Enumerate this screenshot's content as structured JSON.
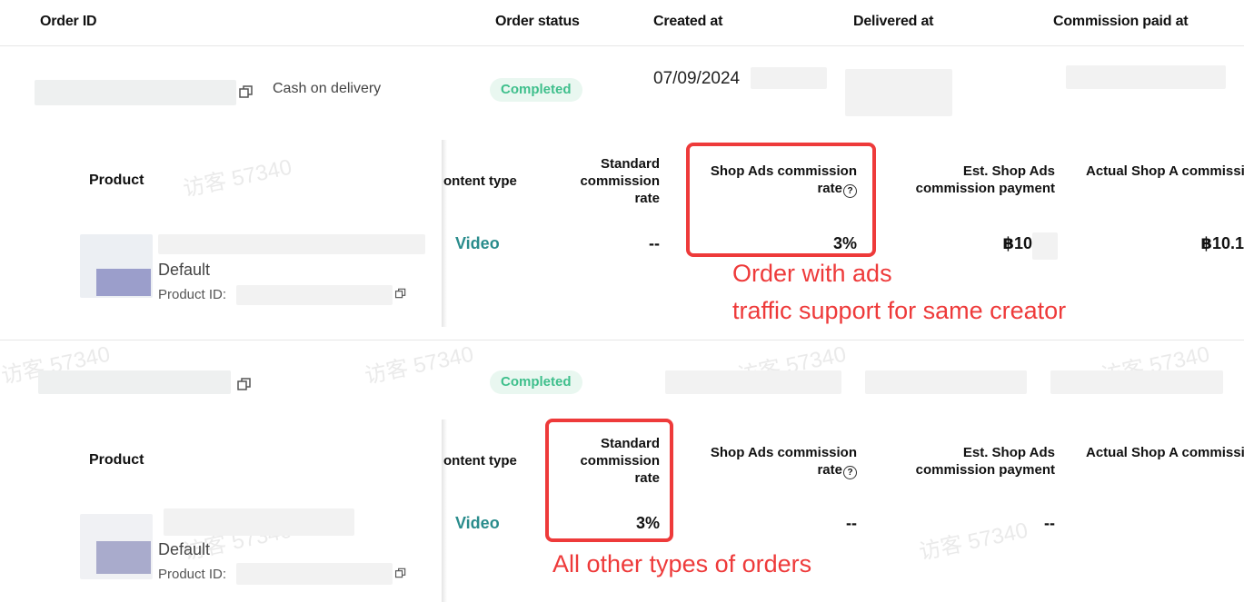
{
  "columns": {
    "order_id": "Order ID",
    "order_status": "Order status",
    "created_at": "Created at",
    "delivered_at": "Delivered at",
    "commission_paid_at": "Commission paid at"
  },
  "orders": [
    {
      "payment_method": "Cash on delivery",
      "status": "Completed",
      "created_date": "07/09/2024",
      "detail": {
        "product_header": "Product",
        "content_type_header": "ontent type",
        "standard_rate_header": "Standard commission rate",
        "shop_ads_rate_header": "Shop Ads commission rate",
        "est_payment_header": "Est. Shop Ads commission payment",
        "actual_payment_header": "Actual Shop A commission payment",
        "help_icon_glyph": "?",
        "variant": "Default",
        "product_id_label": "Product ID:",
        "content_type": "Video",
        "standard_rate": "--",
        "shop_ads_rate": "3%",
        "est_payment": "฿10",
        "actual_payment": "฿10.1"
      },
      "annotation_line1": "Order with ads",
      "annotation_line2": "traffic support for same creator"
    },
    {
      "status": "Completed",
      "detail": {
        "product_header": "Product",
        "content_type_header": "ontent type",
        "standard_rate_header": "Standard commission rate",
        "shop_ads_rate_header": "Shop Ads commission rate",
        "est_payment_header": "Est. Shop Ads commission payment",
        "actual_payment_header": "Actual Shop A commission payment",
        "help_icon_glyph": "?",
        "variant": "Default",
        "product_id_label": "Product ID:",
        "content_type": "Video",
        "standard_rate": "3%",
        "shop_ads_rate": "--",
        "est_payment": "--"
      },
      "annotation": "All other types of orders"
    }
  ],
  "watermark_text": "访客 57340",
  "colors": {
    "status_text": "#3fbf8c",
    "status_bg": "#e9f7f0",
    "video_link": "#2a8c8c",
    "annotation_red": "#ee3a3a"
  }
}
